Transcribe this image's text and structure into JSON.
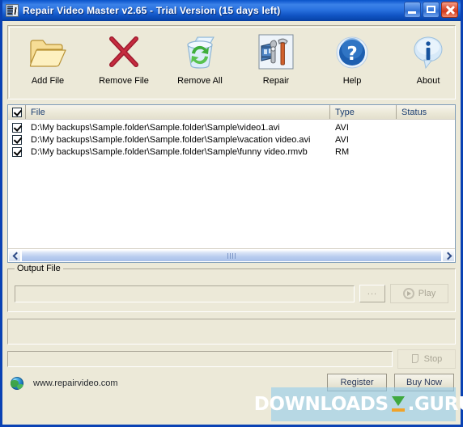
{
  "window": {
    "title": "Repair Video Master v2.65 - Trial Version (15 days left)",
    "minimize_label": "Minimize",
    "maximize_label": "Maximize",
    "close_label": "Close"
  },
  "toolbar": {
    "buttons": [
      {
        "label": "Add File",
        "icon": "open-folder-icon"
      },
      {
        "label": "Remove File",
        "icon": "red-cross-icon"
      },
      {
        "label": "Remove All",
        "icon": "recycle-bin-icon"
      },
      {
        "label": "Repair",
        "icon": "repair-tools-icon"
      },
      {
        "label": "Help",
        "icon": "question-mark-icon"
      },
      {
        "label": "About",
        "icon": "info-bubble-icon"
      }
    ]
  },
  "filelist": {
    "select_all_checked": true,
    "columns": {
      "file": "File",
      "type": "Type",
      "status": "Status"
    },
    "rows": [
      {
        "checked": true,
        "file": "D:\\My backups\\Sample.folder\\Sample.folder\\Sample\\video1.avi",
        "type": "AVI",
        "status": ""
      },
      {
        "checked": true,
        "file": "D:\\My backups\\Sample.folder\\Sample.folder\\Sample\\vacation video.avi",
        "type": "AVI",
        "status": ""
      },
      {
        "checked": true,
        "file": "D:\\My backups\\Sample.folder\\Sample.folder\\Sample\\funny video.rmvb",
        "type": "RM",
        "status": ""
      }
    ]
  },
  "scrollbar": {
    "left_arrow": "chevron-left-icon",
    "right_arrow": "chevron-right-icon"
  },
  "output": {
    "group_title": "Output File",
    "path_value": "",
    "path_placeholder": "",
    "browse_label": "...",
    "play_label": "Play"
  },
  "progress": {
    "value": 0,
    "stop_label": "Stop"
  },
  "footer": {
    "website": "www.repairvideo.com",
    "globe_icon": "globe-icon",
    "register_label": "Register",
    "buynow_label": "Buy Now"
  },
  "watermark": {
    "left_text": "DOWNLOADS",
    "right_text": ".GURU",
    "logo": "download-arrow-icon"
  },
  "colors": {
    "titlebar_blue": "#0a54c8",
    "window_border": "#0a42b4",
    "face": "#ece9d8",
    "header_text": "#1c3f72",
    "watermark_band": "#96cdeb"
  }
}
